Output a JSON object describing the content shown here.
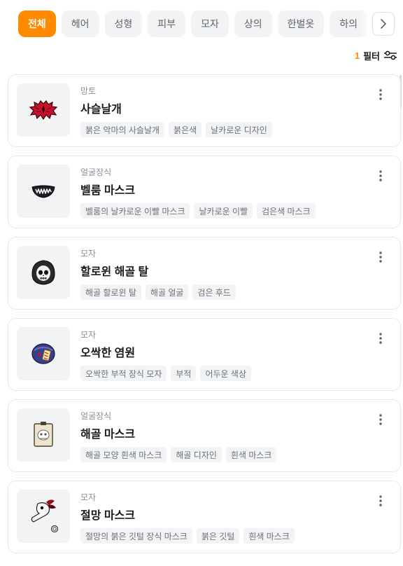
{
  "tabs": [
    "전체",
    "헤어",
    "성형",
    "피부",
    "모자",
    "상의",
    "한벌옷",
    "하의"
  ],
  "filter": {
    "count": "1",
    "label": "필터"
  },
  "icons": {
    "next": "chevron-right-icon",
    "filter": "sliders-icon",
    "menu": "kebab-menu-icon"
  },
  "colors": {
    "accent": "#ff8a00"
  },
  "items": [
    {
      "category": "망토",
      "name": "사슬날개",
      "tags": [
        "붉은 악마의 사슬날개",
        "붉은색",
        "날카로운 디자인"
      ],
      "icon": "red-bat-wings-icon"
    },
    {
      "category": "얼굴장식",
      "name": "벨룸 마스크",
      "tags": [
        "벨룸의 날카로운 이빨 마스크",
        "날카로운 이빨",
        "검은색 마스크"
      ],
      "icon": "fanged-mask-icon"
    },
    {
      "category": "모자",
      "name": "할로윈 해골 탈",
      "tags": [
        "해골 할로윈 탈",
        "해골 얼굴",
        "검은 후드"
      ],
      "icon": "hooded-skull-icon"
    },
    {
      "category": "모자",
      "name": "오싹한 염원",
      "tags": [
        "오싹한 부적 장식 모자",
        "부적",
        "어두운 색상"
      ],
      "icon": "talisman-hat-icon"
    },
    {
      "category": "얼굴장식",
      "name": "해골 마스크",
      "tags": [
        "해골 모양 흰색 마스크",
        "해골 디자인",
        "흰색 마스크"
      ],
      "icon": "skull-mask-icon"
    },
    {
      "category": "모자",
      "name": "절망 마스크",
      "tags": [
        "절망의 붉은 깃털 장식 마스크",
        "붉은 깃털",
        "흰색 마스크"
      ],
      "icon": "plague-mask-icon"
    }
  ]
}
